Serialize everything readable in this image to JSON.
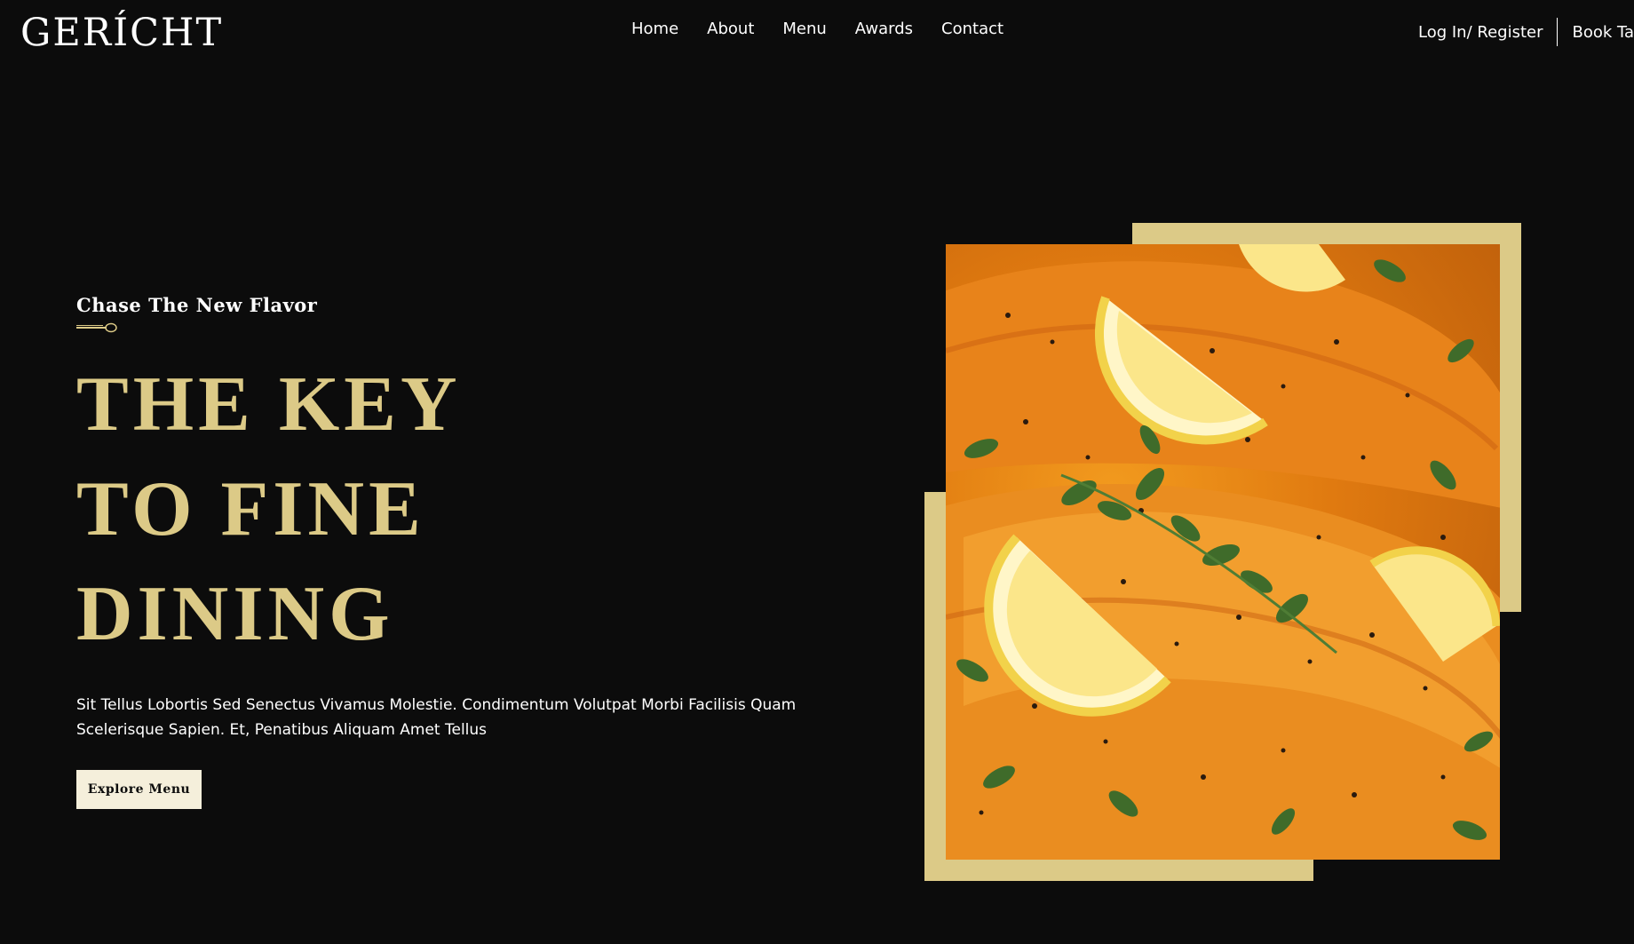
{
  "header": {
    "logo": "GERÍCHT",
    "nav": [
      "Home",
      "About",
      "Menu",
      "Awards",
      "Contact"
    ],
    "login_label": "Log In/ Register",
    "book_label": "Book Table"
  },
  "hero": {
    "subtitle": "Chase The New Flavor",
    "headline": [
      "THE KEY",
      "TO FINE",
      "DINING"
    ],
    "description_lines": [
      "Sit Tellus Lobortis Sed Senectus Vivamus Molestie. Condimentum Volutpat Morbi Facilisis Quam",
      "Scelerisque Sapien. Et, Penatibus Aliquam Amet Tellus"
    ],
    "cta_label": "Explore Menu",
    "image_icon": "salmon-lemon-herbs-image"
  },
  "colors": {
    "background": "#0c0c0c",
    "accent_gold": "#dcca87",
    "button_bg": "#f5efdb",
    "text": "#ffffff"
  }
}
